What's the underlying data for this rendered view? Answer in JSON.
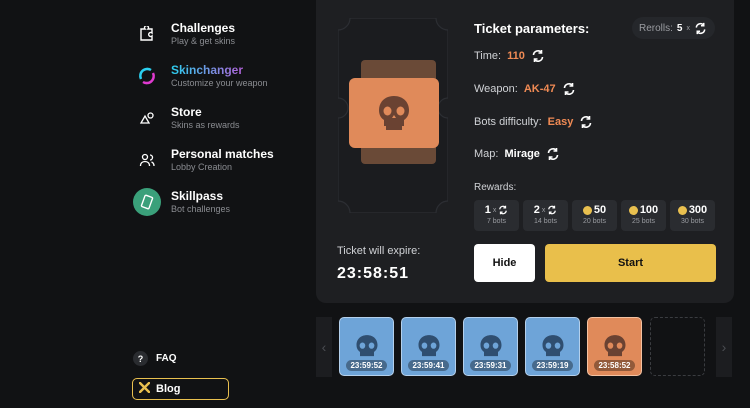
{
  "sidebar": {
    "items": [
      {
        "title": "Challenges",
        "subtitle": "Play & get skins",
        "icon": "puzzle-icon"
      },
      {
        "title": "Skinchanger",
        "subtitle": "Customize your weapon",
        "icon": "skinchanger-icon"
      },
      {
        "title": "Store",
        "subtitle": "Skins as rewards",
        "icon": "store-icon"
      },
      {
        "title": "Personal matches",
        "subtitle": "Lobby Creation",
        "icon": "users-icon"
      },
      {
        "title": "Skillpass",
        "subtitle": "Bot challenges",
        "icon": "skillpass-icon"
      }
    ],
    "faq": {
      "badge": "?",
      "label": "FAQ"
    },
    "blog": {
      "label": "Blog"
    }
  },
  "ticket": {
    "expire_label": "Ticket will expire:",
    "expire_time": "23:58:51"
  },
  "params": {
    "title": "Ticket parameters:",
    "rerolls_label": "Rerolls:",
    "rerolls_value": "5",
    "rerolls_x": "x",
    "time_label": "Time:",
    "time_value": "110",
    "weapon_label": "Weapon:",
    "weapon_value": "AK-47",
    "difficulty_label": "Bots difficulty:",
    "difficulty_value": "Easy",
    "map_label": "Map:",
    "map_value": "Mirage",
    "rewards_label": "Rewards:"
  },
  "rewards": [
    {
      "value": "1",
      "x": "x",
      "sub": "7 bots",
      "kind": "reroll"
    },
    {
      "value": "2",
      "x": "x",
      "sub": "14 bots",
      "kind": "reroll"
    },
    {
      "value": "50",
      "sub": "20 bots",
      "kind": "coin"
    },
    {
      "value": "100",
      "sub": "25 bots",
      "kind": "coin"
    },
    {
      "value": "300",
      "sub": "30 bots",
      "kind": "coin"
    }
  ],
  "buttons": {
    "hide": "Hide",
    "start": "Start"
  },
  "tickets": [
    {
      "time": "23:59:52",
      "color": "blue"
    },
    {
      "time": "23:59:41",
      "color": "blue"
    },
    {
      "time": "23:59:31",
      "color": "blue"
    },
    {
      "time": "23:59:19",
      "color": "blue"
    },
    {
      "time": "23:58:52",
      "color": "orange"
    }
  ],
  "colors": {
    "accent": "#e9bf4b",
    "orange": "#f08a54",
    "tile_blue": "#6ea4d8",
    "tile_orange": "#e08a5a"
  }
}
